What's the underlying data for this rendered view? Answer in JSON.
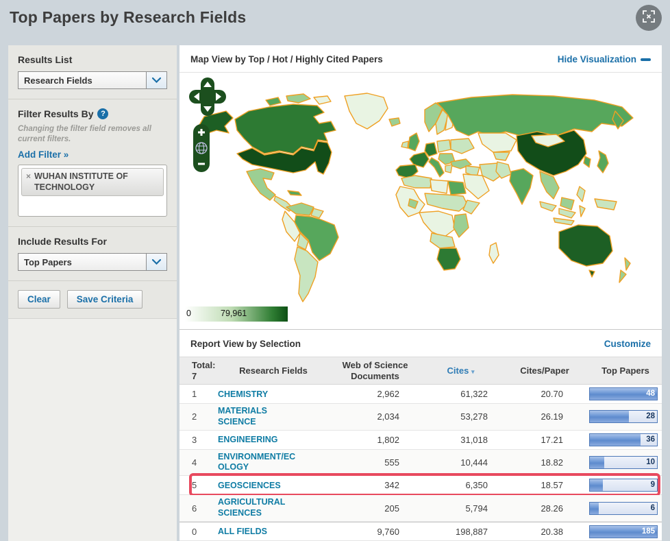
{
  "page": {
    "title": "Top Papers by Research Fields"
  },
  "sidebar": {
    "results_list": {
      "label": "Results List",
      "selected": "Research Fields"
    },
    "filter": {
      "label": "Filter Results By",
      "help_glyph": "?",
      "note": "Changing the filter field removes all current filters.",
      "add_filter": "Add Filter »",
      "tag": {
        "remove_glyph": "×",
        "label": "WUHAN INSTITUTE OF TECHNOLOGY"
      }
    },
    "include": {
      "label": "Include Results For",
      "selected": "Top Papers"
    },
    "buttons": {
      "clear": "Clear",
      "save": "Save Criteria"
    }
  },
  "map": {
    "title": "Map View by Top / Hot / Highly Cited Papers",
    "hide_link": "Hide Visualization",
    "legend": {
      "min": "0",
      "max": "79,961"
    },
    "zoom_in_glyph": "+",
    "zoom_out_glyph": "−",
    "colors": {
      "border": "#EFA023",
      "scale_low": "#FFFFFF",
      "scale_high": "#0D5014",
      "control_green": "#1C4F1E"
    }
  },
  "report": {
    "title": "Report View by Selection",
    "customize": "Customize",
    "table": {
      "total_label": "Total:",
      "total_value": "7",
      "headers": {
        "field": "Research Fields",
        "docs": "Web of Science Documents",
        "cites": "Cites",
        "sort_glyph": "▾",
        "cites_per_paper": "Cites/Paper",
        "top_papers": "Top Papers"
      },
      "rows": [
        {
          "rank": "1",
          "field": "CHEMISTRY",
          "docs": "2,962",
          "cites": "61,322",
          "cites_per_paper": "20.70",
          "top_papers": "48",
          "bar_pct": 100,
          "highlighted": false
        },
        {
          "rank": "2",
          "field": "MATERIALS SCIENCE",
          "docs": "2,034",
          "cites": "53,278",
          "cites_per_paper": "26.19",
          "top_papers": "28",
          "bar_pct": 58,
          "highlighted": false
        },
        {
          "rank": "3",
          "field": "ENGINEERING",
          "docs": "1,802",
          "cites": "31,018",
          "cites_per_paper": "17.21",
          "top_papers": "36",
          "bar_pct": 75,
          "highlighted": false
        },
        {
          "rank": "4",
          "field": "ENVIRONMENT/ECOLOGY",
          "docs": "555",
          "cites": "10,444",
          "cites_per_paper": "18.82",
          "top_papers": "10",
          "bar_pct": 21,
          "highlighted": false
        },
        {
          "rank": "5",
          "field": "GEOSCIENCES",
          "docs": "342",
          "cites": "6,350",
          "cites_per_paper": "18.57",
          "top_papers": "9",
          "bar_pct": 19,
          "highlighted": true
        },
        {
          "rank": "6",
          "field": "AGRICULTURAL SCIENCES",
          "docs": "205",
          "cites": "5,794",
          "cites_per_paper": "28.26",
          "top_papers": "6",
          "bar_pct": 13,
          "highlighted": false
        },
        {
          "rank": "0",
          "field": "ALL FIELDS",
          "docs": "9,760",
          "cites": "198,887",
          "cites_per_paper": "20.38",
          "top_papers": "185",
          "bar_pct": 100,
          "highlighted": false
        }
      ]
    }
  }
}
